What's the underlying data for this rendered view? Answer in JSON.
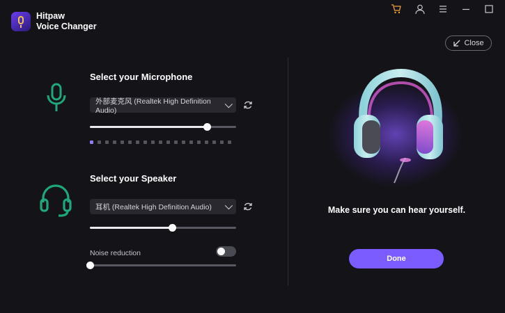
{
  "app": {
    "name_line1": "Hitpaw",
    "name_line2": "Voice Changer"
  },
  "titlebar": {
    "icons": [
      "cart-icon",
      "user-icon",
      "menu-icon",
      "minimize-icon",
      "maximize-icon"
    ],
    "close_label": "Close"
  },
  "microphone": {
    "title": "Select your Microphone",
    "device": "外部麦克风 (Realtek High Definition Audio)",
    "volume": 0.8,
    "level_segments": 19,
    "level_active": 1
  },
  "speaker": {
    "title": "Select your Speaker",
    "device": "耳机 (Realtek High Definition Audio)",
    "volume": 0.56
  },
  "noise": {
    "label": "Noise reduction",
    "enabled": false,
    "level": 0.0
  },
  "test": {
    "hint": "Make sure you can hear yourself.",
    "done_label": "Done"
  },
  "colors": {
    "accent": "#7a5cff",
    "icon_green": "#1fa77a",
    "background": "#141318"
  }
}
